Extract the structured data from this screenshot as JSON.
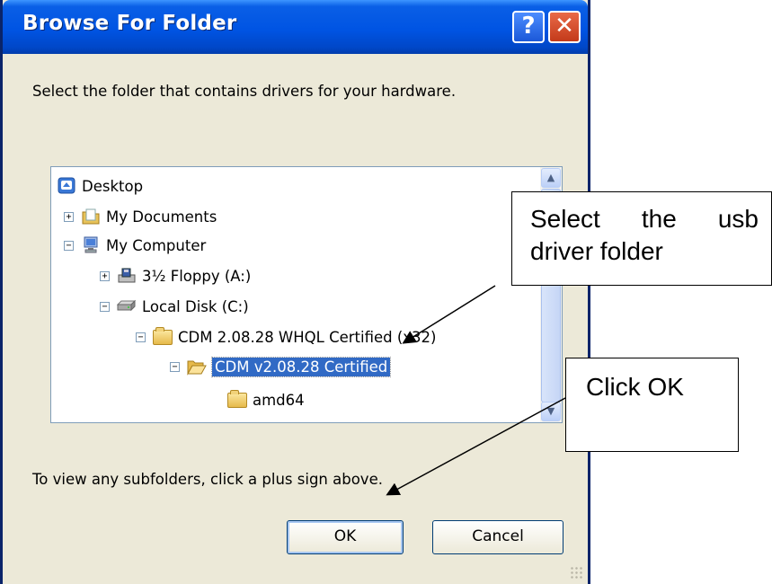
{
  "dialog": {
    "title": "Browse For Folder",
    "help_button": "?",
    "close_button": "✕",
    "instruction": "Select the folder that contains drivers for your hardware.",
    "tree": {
      "items": [
        {
          "label": "Desktop",
          "icon": "desktop-icon",
          "expander": ""
        },
        {
          "label": "My Documents",
          "icon": "my-documents-icon",
          "expander": "+"
        },
        {
          "label": "My Computer",
          "icon": "my-computer-icon",
          "expander": "−"
        },
        {
          "label": "3½ Floppy (A:)",
          "icon": "floppy-drive-icon",
          "expander": "+"
        },
        {
          "label": "Local Disk (C:)",
          "icon": "hard-disk-icon",
          "expander": "−"
        },
        {
          "label": "CDM 2.08.28 WHQL Certified (x32)",
          "icon": "folder-icon",
          "expander": "−"
        },
        {
          "label": "CDM v2.08.28 Certified",
          "icon": "open-folder-icon",
          "expander": "−",
          "selected": true
        },
        {
          "label": "amd64",
          "icon": "folder-icon",
          "expander": ""
        }
      ]
    },
    "footer_text": "To view any subfolders, click a plus sign above.",
    "ok_label": "OK",
    "cancel_label": "Cancel"
  },
  "callouts": {
    "select_usb": {
      "line1_words": [
        "Select",
        "the",
        "usb"
      ],
      "line2": "driver folder"
    },
    "click_ok": "Click OK"
  },
  "colors": {
    "titlebar": "#0054e3",
    "dialog_bg": "#ece9d8",
    "selection": "#316ac5"
  }
}
